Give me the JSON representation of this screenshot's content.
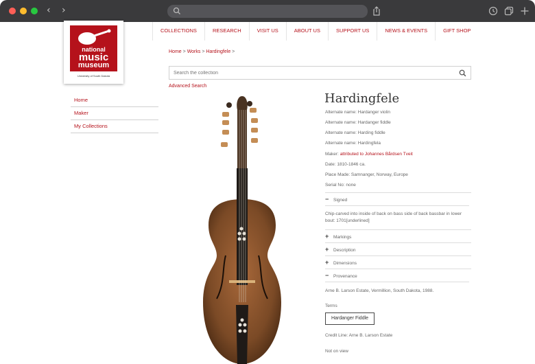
{
  "browser": {
    "nav_arrows": "‹  ›"
  },
  "logo": {
    "line1": "national",
    "line2": "music",
    "line3": "museum",
    "subtitle": "University of South Dakota"
  },
  "topnav": [
    "COLLECTIONS",
    "RESEARCH",
    "VISIT US",
    "ABOUT US",
    "SUPPORT US",
    "NEWS & EVENTS",
    "GIFT SHOP"
  ],
  "breadcrumb": {
    "home": "Home",
    "sep": ">",
    "works": "Works",
    "current": "Hardingfele"
  },
  "search": {
    "placeholder": "Search the collection",
    "advanced": "Advanced Search"
  },
  "sidebar": [
    "Home",
    "Maker",
    "My Collections"
  ],
  "item": {
    "title": "Hardingfele",
    "alt_names": [
      "Alternate name:  Hardanger violin",
      "Alternate name:  Hardanger fiddle",
      "Alternate name:  Harding fiddle",
      "Alternate name:  Hardingfela"
    ],
    "maker_label": "Maker:",
    "maker_value": "attributed to Johannes Bårdsen Tveit",
    "date": "Date:  1810-1846 ca.",
    "place": "Place Made:  Samnanger, Norway, Europe",
    "serial": "Serial No:  none",
    "sections": {
      "signed": "Signed",
      "signed_text": "Chip-carved into inside of back on bass side of back bassbar in lower bout: 1701[underlined]",
      "markings": "Markings",
      "description": "Description",
      "dimensions": "Dimensions",
      "provenance": "Provenance",
      "provenance_text": "Arne B. Larson Estate, Vermillion, South Dakota, 1988."
    },
    "terms_label": "Terms",
    "term": "Hardanger Fiddle",
    "credit": "Credit Line:  Arne B. Larson Estate",
    "status": "Not on view"
  },
  "colors": {
    "accent": "#b5121b",
    "titlebar": "#3a3a3c"
  },
  "icons": [
    "search-icon",
    "share-icon",
    "history-icon",
    "tabs-icon",
    "plus-icon",
    "minus-icon",
    "violin-image"
  ]
}
